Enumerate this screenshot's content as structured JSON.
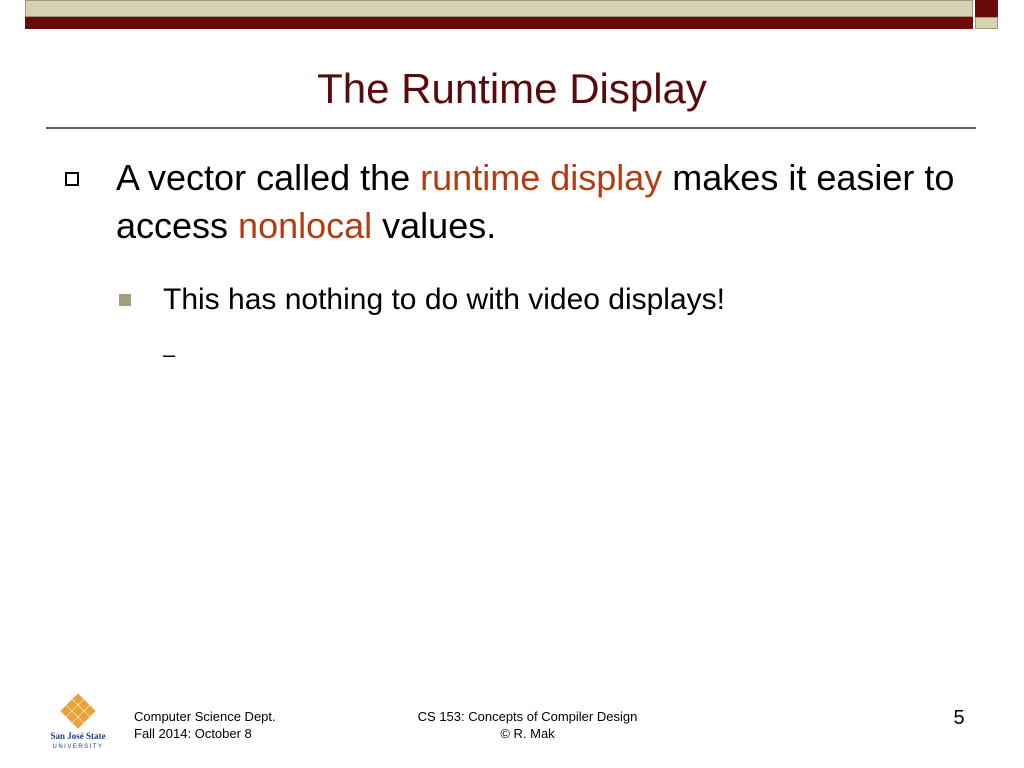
{
  "slide": {
    "title": "The Runtime Display",
    "bullet1": {
      "part1": "A vector called the ",
      "highlight1": "runtime display",
      "part2": " makes it easier to access ",
      "highlight2": "nonlocal",
      "part3": " values."
    },
    "bullet2": "This has nothing to do with video displays!",
    "bullet3": "–"
  },
  "footer": {
    "left_line1": "Computer Science Dept.",
    "left_line2": "Fall 2014: October 8",
    "center_line1": "CS 153: Concepts of Compiler Design",
    "center_line2": "© R. Mak",
    "page_number": "5",
    "logo_line1": "San José State",
    "logo_line2": "UNIVERSITY"
  },
  "colors": {
    "title": "#5a0a0a",
    "highlight": "#b23c10",
    "bar_maroon": "#6b0a0a",
    "bar_olive": "#d6d3b4",
    "logo_gold": "#e8a33a",
    "logo_blue": "#1a3c8c"
  }
}
